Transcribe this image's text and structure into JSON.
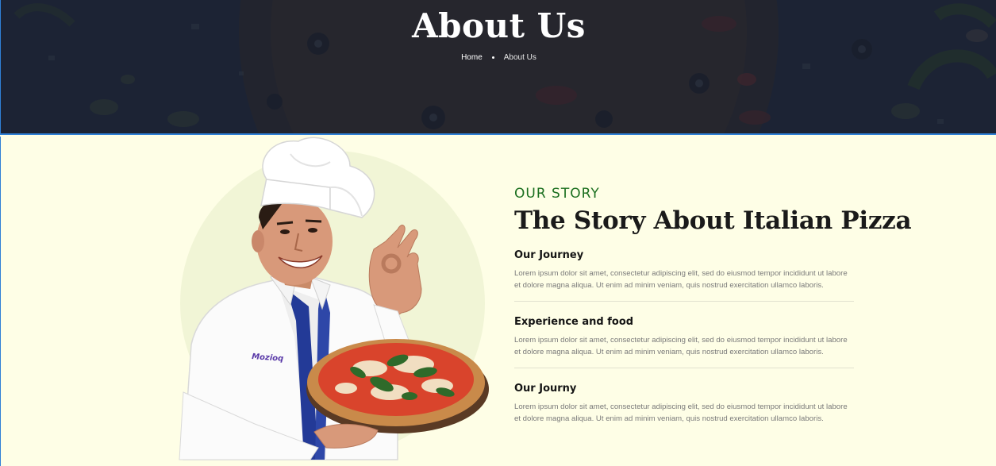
{
  "hero": {
    "title": "About Us",
    "breadcrumb": {
      "home": "Home",
      "current": "About Us"
    }
  },
  "story": {
    "eyebrow": "OUR STORY",
    "heading": "The Story About Italian Pizza",
    "items": [
      {
        "title": "Our Journey",
        "text": "Lorem ipsum dolor sit amet, consectetur adipiscing elit, sed do eiusmod tempor incididunt ut labore et dolore magna aliqua. Ut enim ad minim veniam, quis nostrud exercitation ullamco laboris."
      },
      {
        "title": "Experience and food",
        "text": "Lorem ipsum dolor sit amet, consectetur adipiscing elit, sed do eiusmod tempor incididunt ut labore et dolore magna aliqua. Ut enim ad minim veniam, quis nostrud exercitation ullamco laboris."
      },
      {
        "title": "Our Journy",
        "text": "Lorem ipsum dolor sit amet, consectetur adipiscing elit, sed do eiusmod tempor incididunt ut labore et dolore magna aliqua. Ut enim ad minim veniam, quis nostrud exercitation ullamco laboris."
      }
    ]
  },
  "chef": {
    "shirt_logo": "Mozioq"
  },
  "colors": {
    "hero_bg": "#1e2637",
    "page_bg": "#fefee6",
    "accent_green": "#1b6f1f",
    "heading_dark": "#1a1a1a",
    "body_text": "#7a7a7a"
  }
}
